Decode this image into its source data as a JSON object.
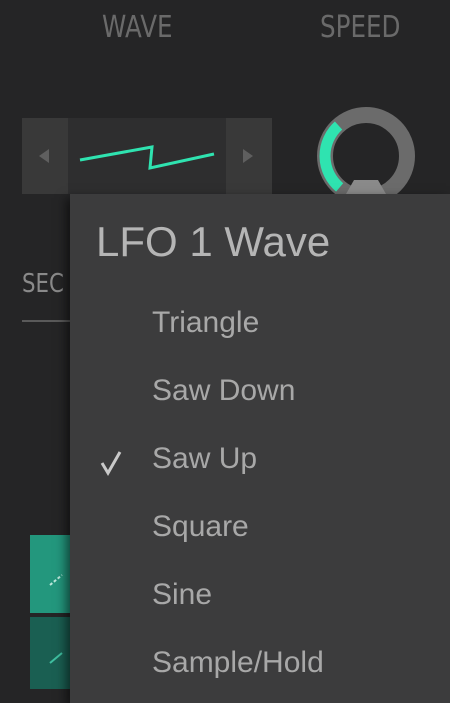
{
  "panel": {
    "wave_header": "WAVE",
    "speed_header": "SPEED",
    "section_label_partial": "SEC",
    "wave_selector": {
      "prev_icon": "triangle-left-icon",
      "next_icon": "triangle-right-icon",
      "current_wave_icon": "saw-up-wave-icon"
    },
    "speed_knob": {
      "level_fraction": 0.35
    }
  },
  "menu": {
    "title": "LFO 1 Wave",
    "items": [
      {
        "label": "Triangle",
        "checked": false
      },
      {
        "label": "Saw Down",
        "checked": false
      },
      {
        "label": "Saw Up",
        "checked": true
      },
      {
        "label": "Square",
        "checked": false
      },
      {
        "label": "Sine",
        "checked": false
      },
      {
        "label": "Sample/Hold",
        "checked": false
      }
    ],
    "check_icon": "checkmark-icon"
  },
  "colors": {
    "accent": "#2fe3b0",
    "menu_bg": "#3c3c3d",
    "panel_bg": "#252526",
    "text_dim": "#6a6a6a",
    "text_menu": "#a8a8a8"
  }
}
